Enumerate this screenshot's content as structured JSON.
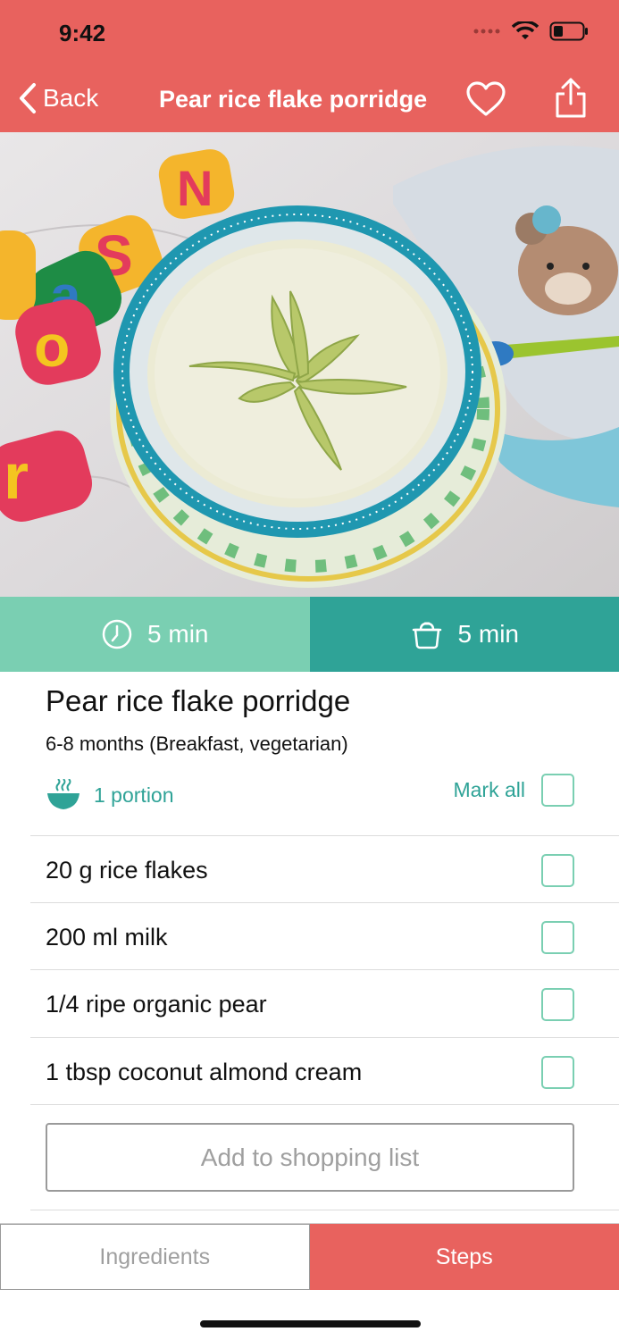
{
  "status_bar": {
    "time": "9:42"
  },
  "nav": {
    "back_label": "Back",
    "title": "Pear rice flake porridge"
  },
  "times": {
    "prep": "5 min",
    "cook": "5 min"
  },
  "recipe": {
    "title": "Pear rice flake porridge",
    "subtitle": "6-8 months (Breakfast, vegetarian)",
    "portion": "1 portion",
    "mark_all": "Mark all"
  },
  "ingredients": [
    "20 g rice flakes",
    "200 ml milk",
    "1/4 ripe organic pear",
    "1 tbsp coconut almond cream"
  ],
  "shopping_button": "Add to shopping list",
  "tabs": {
    "ingredients": "Ingredients",
    "steps": "Steps"
  },
  "colors": {
    "brand": "#e8625e",
    "teal_light": "#7acfb2",
    "teal_dark": "#2fa397"
  }
}
